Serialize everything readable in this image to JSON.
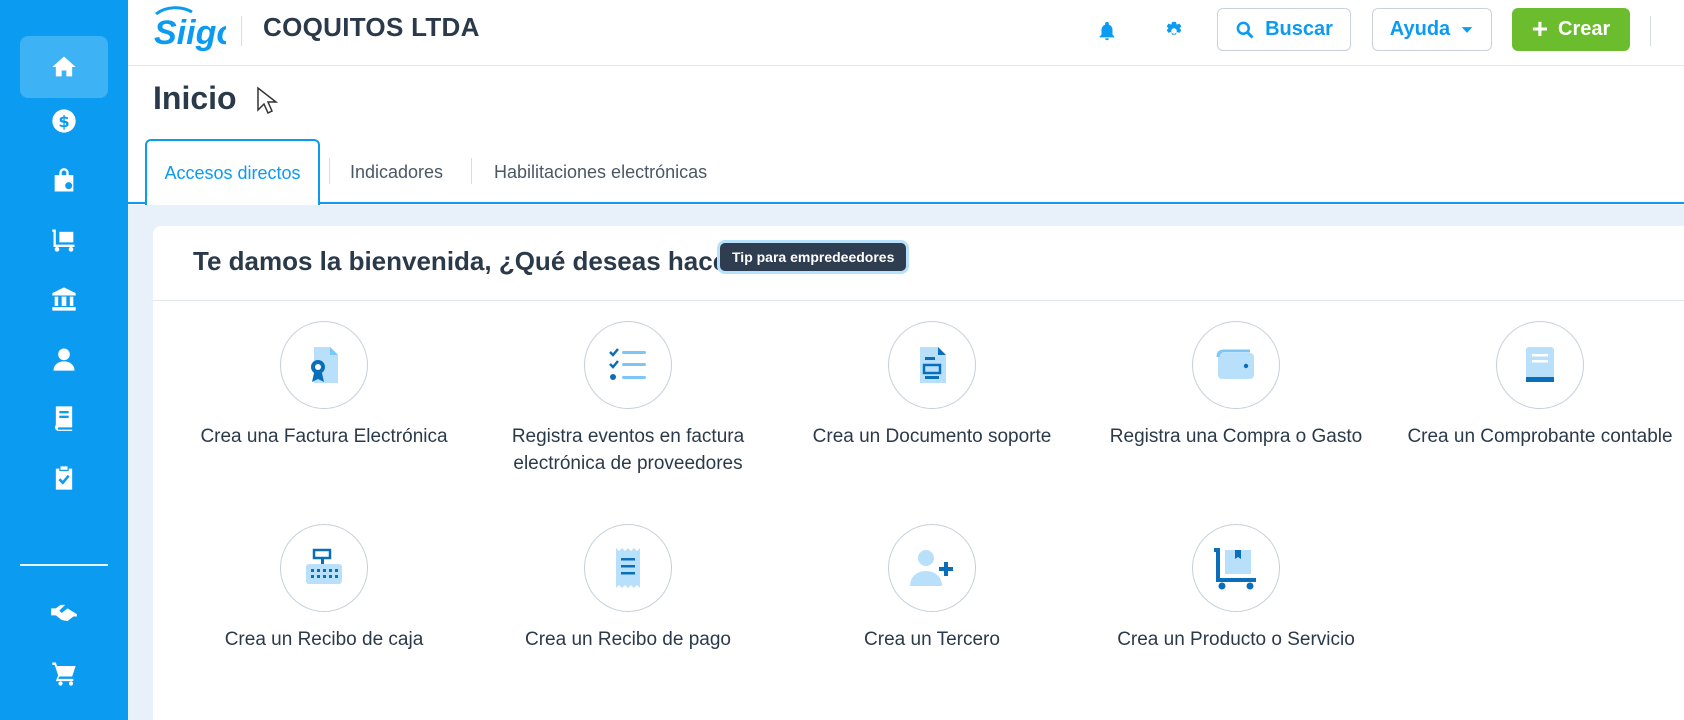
{
  "header": {
    "logo_text": "Siigo",
    "company": "COQUITOS LTDA",
    "search_label": "Buscar",
    "help_label": "Ayuda",
    "create_label": "Crear"
  },
  "sidebar": {
    "items": [
      {
        "icon": "home-icon"
      },
      {
        "icon": "dollar-icon"
      },
      {
        "icon": "shopping-bag-icon"
      },
      {
        "icon": "cart-dolly-icon"
      },
      {
        "icon": "bank-icon"
      },
      {
        "icon": "user-icon"
      },
      {
        "icon": "book-icon"
      },
      {
        "icon": "clipboard-check-icon"
      },
      {
        "icon": "handshake-icon"
      },
      {
        "icon": "shopping-cart-icon"
      }
    ]
  },
  "page": {
    "title": "Inicio"
  },
  "tabs": [
    {
      "label": "Accesos directos"
    },
    {
      "label": "Indicadores"
    },
    {
      "label": "Habilitaciones electrónicas"
    }
  ],
  "main": {
    "welcome": "Te damos la bienvenida, ¿Qué deseas hacer",
    "tip": "Tip para empredTip para empredeedores"
  },
  "actions": [
    {
      "label": "Crea una Factura Electrónica",
      "icon": "invoice-award-icon"
    },
    {
      "label": "Registra eventos en factura electrónica de proveedores",
      "icon": "checklist-icon"
    },
    {
      "label": "Crea un Documento soporte",
      "icon": "document-icon"
    },
    {
      "label": "Registra una Compra o Gasto",
      "icon": "wallet-icon"
    },
    {
      "label": "Crea un Comprobante contable",
      "icon": "ledger-book-icon"
    },
    {
      "label": "Crea un Recibo de caja",
      "icon": "cash-register-icon"
    },
    {
      "label": "Crea un Recibo de pago",
      "icon": "receipt-icon"
    },
    {
      "label": "Crea un Tercero",
      "icon": "add-user-icon"
    },
    {
      "label": "Crea un Producto o Servicio",
      "icon": "product-cart-icon"
    }
  ],
  "colors": {
    "brand_blue": "#0b9bf0",
    "green": "#6cbd2d",
    "text_dark": "#2b3a4a"
  }
}
